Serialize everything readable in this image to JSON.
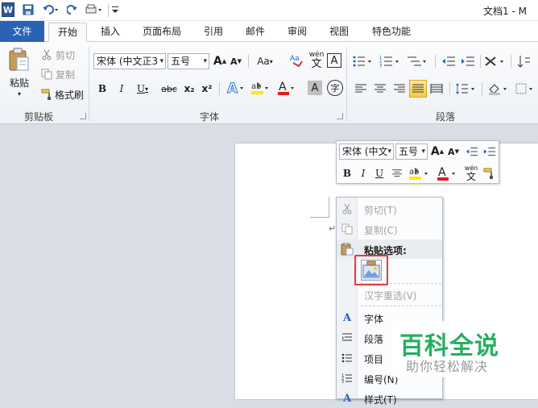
{
  "titlebar": {
    "doc_title": "文档1 - M",
    "app_badge": "W"
  },
  "tabs": [
    "文件",
    "开始",
    "插入",
    "页面布局",
    "引用",
    "邮件",
    "审阅",
    "视图",
    "特色功能"
  ],
  "clipboard": {
    "paste": "粘贴",
    "cut": "剪切",
    "copy": "复制",
    "format_painter": "格式刷",
    "group_label": "剪贴板"
  },
  "font": {
    "font_name": "宋体 (中文正3",
    "font_size": "五号",
    "change_case": "Aa",
    "group_label": "字体",
    "bold": "B",
    "italic": "I",
    "underline": "U",
    "strike": "abc",
    "subscript": "x₂",
    "superscript": "x²",
    "font_color_letter": "A",
    "phonetic": "wén",
    "char_border": "A",
    "enclose": "字"
  },
  "paragraph": {
    "group_label": "段落"
  },
  "mini_toolbar": {
    "font_name": "宋体 (中文",
    "font_size": "五号",
    "bold": "B",
    "italic": "I",
    "underline": "U",
    "phonetic": "wén",
    "font_color_letter": "A"
  },
  "context_menu": {
    "items": [
      {
        "label": "剪切(T)",
        "disabled": true
      },
      {
        "label": "复制(C)",
        "disabled": true
      },
      {
        "label": "粘贴选项:",
        "header": true
      },
      {
        "label": "汉字重选(V)",
        "disabled": true
      },
      {
        "label": "字体"
      },
      {
        "label": "段落"
      },
      {
        "label": "项目"
      },
      {
        "label": "编号(N)"
      },
      {
        "label": "样式(T)"
      }
    ]
  },
  "watermark": {
    "title": "百科全说",
    "subtitle": "助你轻松解决"
  },
  "colors": {
    "accent_blue": "#2a62b5",
    "watermark_green": "#27ae60",
    "highlight_red": "#e43a3a"
  }
}
